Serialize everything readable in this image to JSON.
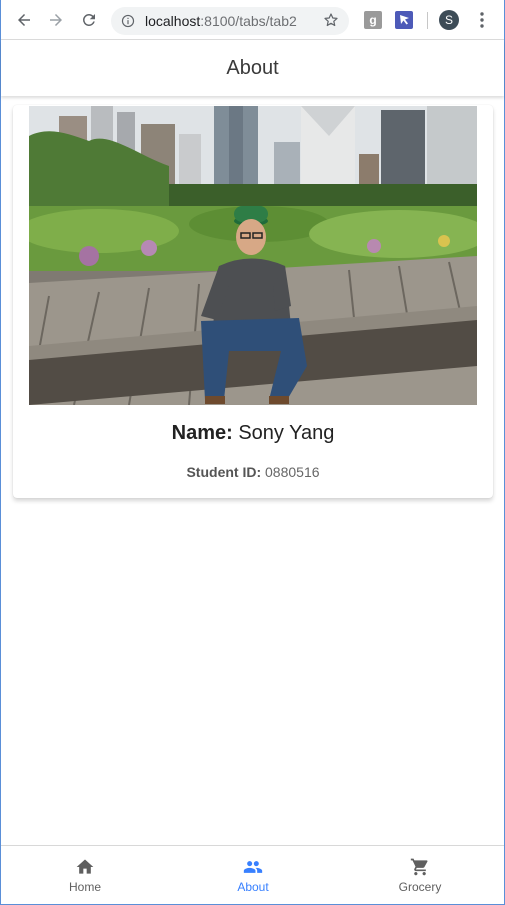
{
  "browser": {
    "url_host": "localhost",
    "url_path": ":8100/tabs/tab2",
    "ext_g_label": "g",
    "profile_initial": "S",
    "back_icon": "arrow-left-icon",
    "forward_icon": "arrow-right-icon",
    "reload_icon": "reload-icon",
    "info_icon": "info-icon",
    "bookmark_icon": "star-icon",
    "menu_icon": "kebab-menu-icon"
  },
  "header": {
    "title": "About"
  },
  "profile": {
    "photo_description_icon": "profile-photo",
    "name_label": "Name:",
    "name_value": "Sony Yang",
    "student_id_label": "Student ID:",
    "student_id_value": "0880516"
  },
  "tabs": [
    {
      "label": "Home",
      "icon": "home-icon",
      "active": false
    },
    {
      "label": "About",
      "icon": "people-icon",
      "active": true
    },
    {
      "label": "Grocery",
      "icon": "cart-icon",
      "active": false
    }
  ],
  "colors": {
    "accent": "#3880ff",
    "inactive_tab": "#5f5f5f",
    "window_border": "#5a8fd8"
  }
}
